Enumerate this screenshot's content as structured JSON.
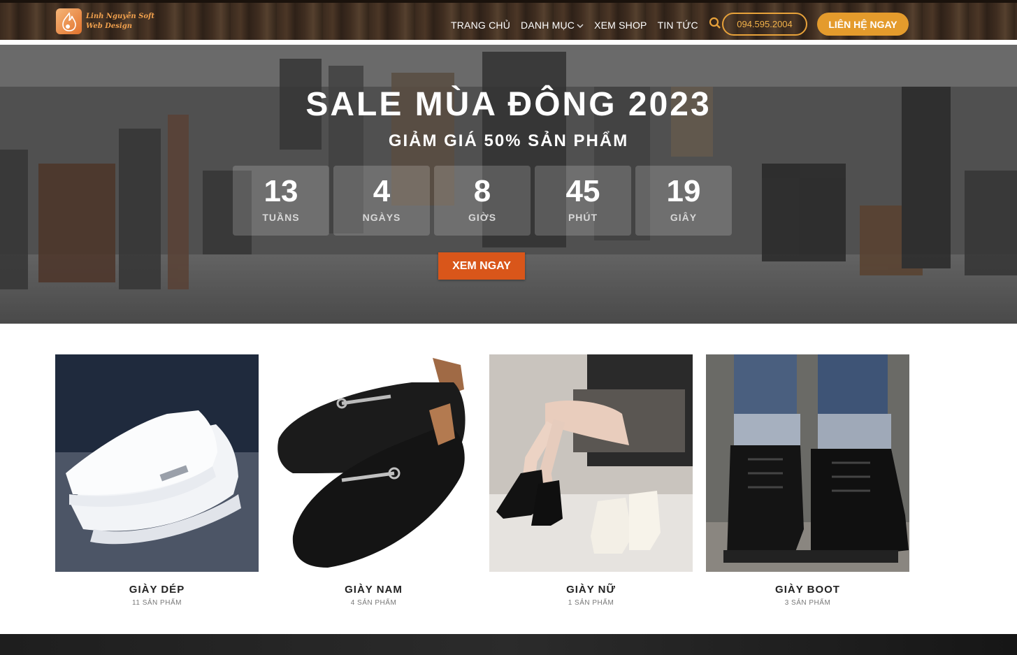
{
  "header": {
    "logo_line1": "Linh Nguyễn Soft",
    "logo_line2": "Web Design",
    "nav": [
      "TRANG CHỦ",
      "DANH MỤC",
      "XEM SHOP",
      "TIN TỨC"
    ],
    "phone": "094.595.2004",
    "contact_label": "LIÊN HỆ NGAY",
    "accent": "#e49b2c"
  },
  "hero": {
    "title": "SALE MÙA ĐÔNG 2023",
    "subtitle": "GIẢM GIÁ 50% SẢN PHẨM",
    "countdown": [
      {
        "value": "13",
        "label": "TUẦNS"
      },
      {
        "value": "4",
        "label": "NGÀYS"
      },
      {
        "value": "8",
        "label": "GIỜS"
      },
      {
        "value": "45",
        "label": "PHÚT"
      },
      {
        "value": "19",
        "label": "GIÂY"
      }
    ],
    "cta_label": "XEM NGAY",
    "cta_color": "#d9561a"
  },
  "categories": [
    {
      "name": "GIÀY DÉP",
      "count": "11 SẢN PHẨM"
    },
    {
      "name": "GIÀY NAM",
      "count": "4 SẢN PHẨM"
    },
    {
      "name": "GIÀY NỮ",
      "count": "1 SẢN PHẨM"
    },
    {
      "name": "GIÀY BOOT",
      "count": "3 SẢN PHẨM"
    }
  ]
}
